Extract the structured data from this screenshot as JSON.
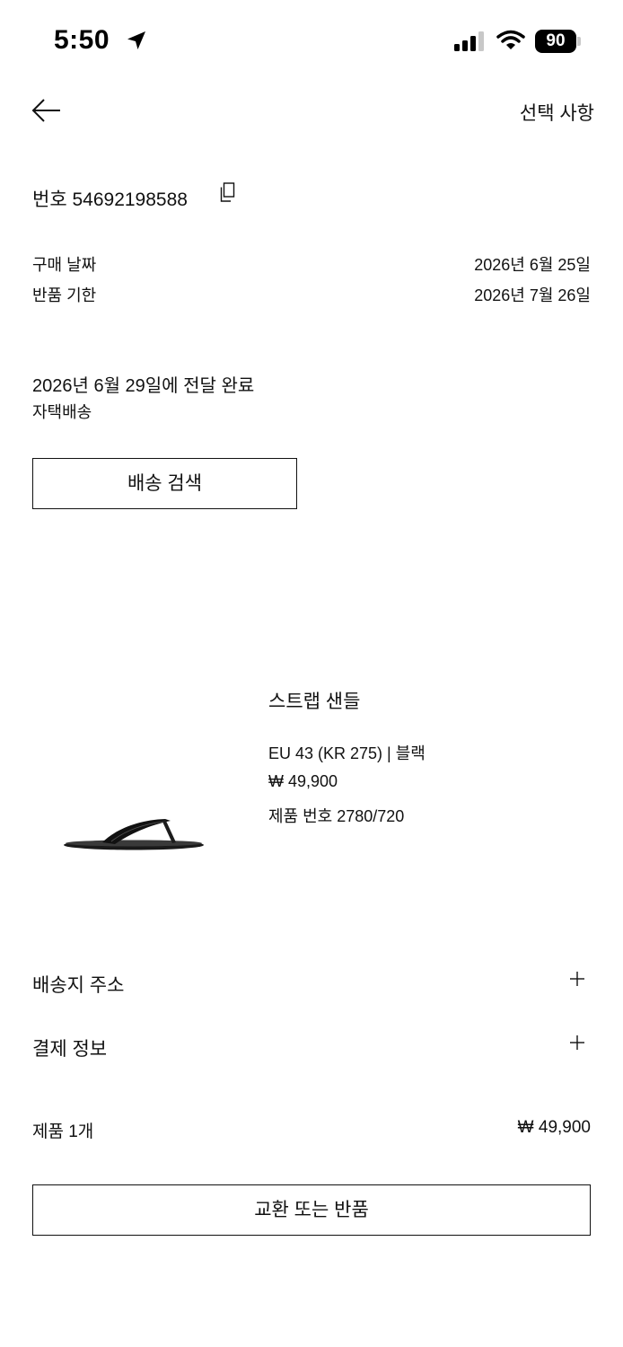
{
  "status_bar": {
    "time": "5:50",
    "battery": "90"
  },
  "header": {
    "options_label": "선택 사항"
  },
  "order": {
    "number_label": "번호 54692198588",
    "purchase_date_label": "구매 날짜",
    "purchase_date_value": "2026년 6월 25일",
    "return_deadline_label": "반품 기한",
    "return_deadline_value": "2026년 7월 26일",
    "delivery_status": "2026년 6월 29일에 전달 완료",
    "delivery_method": "자택배송",
    "track_button": "배송 검색"
  },
  "product": {
    "name": "스트랩 샌들",
    "variant": "EU 43 (KR 275) | 블랙",
    "price": "₩ 49,900",
    "reference": "제품 번호 2780/720"
  },
  "sections": {
    "shipping_address": "배송지 주소",
    "payment_info": "결제 정보"
  },
  "summary": {
    "items_label": "제품 1개",
    "total": "₩ 49,900"
  },
  "return_button": "교환 또는 반품",
  "icons": {
    "location": "location-arrow-icon",
    "signal": "cellular-signal-icon",
    "wifi": "wifi-icon",
    "battery": "battery-icon",
    "back": "back-arrow-icon",
    "copy": "copy-icon",
    "expand": "plus-icon"
  }
}
